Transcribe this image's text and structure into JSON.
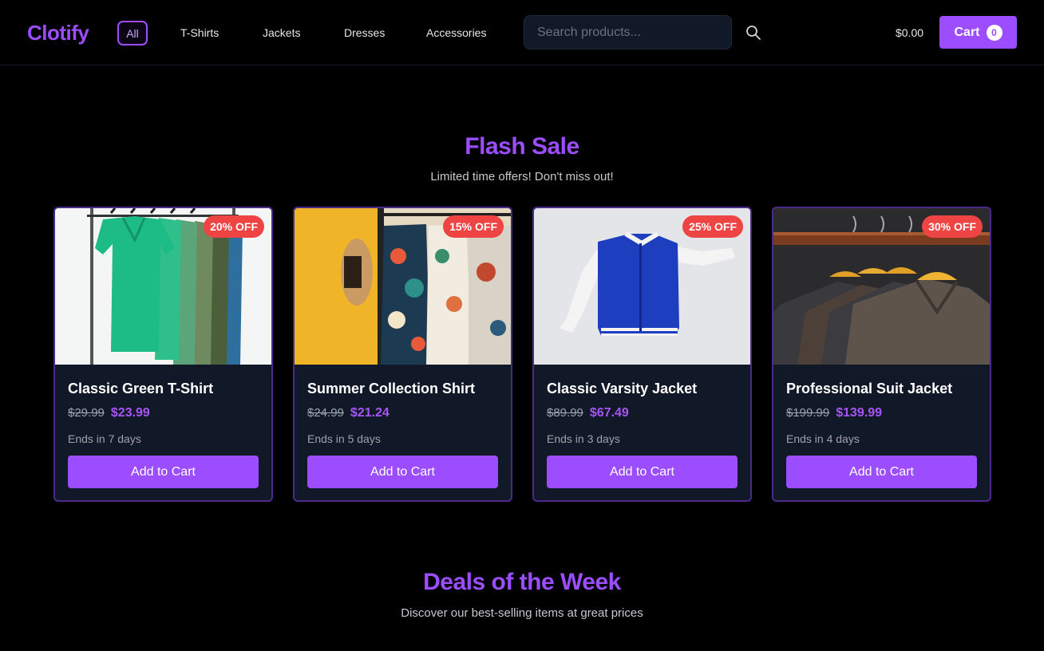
{
  "brand": {
    "name": "Clotify",
    "accent": "#9b4dff"
  },
  "nav": {
    "all_label": "All",
    "links": [
      "T-Shirts",
      "Jackets",
      "Dresses",
      "Accessories"
    ]
  },
  "search": {
    "placeholder": "Search products...",
    "value": ""
  },
  "cart": {
    "total": "$0.00",
    "label": "Cart",
    "count": "0"
  },
  "flash_sale": {
    "title": "Flash Sale",
    "subtitle": "Limited time offers! Don't miss out!",
    "products": [
      {
        "name": "Classic Green T-Shirt",
        "old_price": "$29.99",
        "new_price": "$23.99",
        "discount": "20% OFF",
        "ends": "Ends in 7 days",
        "button": "Add to Cart"
      },
      {
        "name": "Summer Collection Shirt",
        "old_price": "$24.99",
        "new_price": "$21.24",
        "discount": "15% OFF",
        "ends": "Ends in 5 days",
        "button": "Add to Cart"
      },
      {
        "name": "Classic Varsity Jacket",
        "old_price": "$89.99",
        "new_price": "$67.49",
        "discount": "25% OFF",
        "ends": "Ends in 3 days",
        "button": "Add to Cart"
      },
      {
        "name": "Professional Suit Jacket",
        "old_price": "$199.99",
        "new_price": "$139.99",
        "discount": "30% OFF",
        "ends": "Ends in 4 days",
        "button": "Add to Cart"
      }
    ]
  },
  "deals": {
    "title": "Deals of the Week",
    "subtitle": "Discover our best-selling items at great prices"
  },
  "icons": {
    "search": "search-icon",
    "cart": "cart-button"
  }
}
